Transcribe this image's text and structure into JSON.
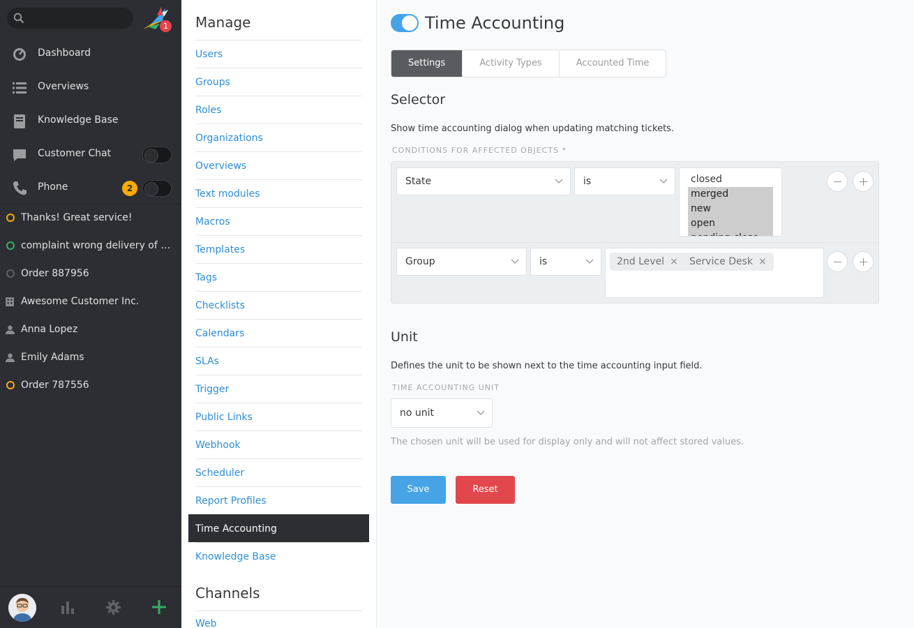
{
  "sidebar": {
    "search_placeholder": "",
    "logo_badge": "1",
    "nav": [
      {
        "label": "Dashboard",
        "icon": "dashboard-icon"
      },
      {
        "label": "Overviews",
        "icon": "overviews-icon"
      },
      {
        "label": "Knowledge Base",
        "icon": "knowledge-base-icon"
      },
      {
        "label": "Customer Chat",
        "icon": "chat-icon"
      },
      {
        "label": "Phone",
        "icon": "phone-icon",
        "badge": "2"
      }
    ],
    "tasks": [
      {
        "label": "Thanks! Great service!",
        "icon": "ticket-open-icon",
        "color": "#faab00"
      },
      {
        "label": "complaint wrong delivery of ord...",
        "icon": "ticket-new-icon",
        "color": "#38ad69"
      },
      {
        "label": "Order 887956",
        "icon": "ticket-closed-icon",
        "color": "#5e6166"
      },
      {
        "label": "Awesome Customer Inc.",
        "icon": "organization-icon",
        "color": "#8a8c90"
      },
      {
        "label": "Anna Lopez",
        "icon": "user-icon",
        "color": "#8a8c90"
      },
      {
        "label": "Emily Adams",
        "icon": "user-icon",
        "color": "#8a8c90"
      },
      {
        "label": "Order 787556",
        "icon": "ticket-pending-icon",
        "color": "#faab00"
      }
    ]
  },
  "manage": {
    "title": "Manage",
    "items": [
      "Users",
      "Groups",
      "Roles",
      "Organizations",
      "Overviews",
      "Text modules",
      "Macros",
      "Templates",
      "Tags",
      "Checklists",
      "Calendars",
      "SLAs",
      "Trigger",
      "Public Links",
      "Webhook",
      "Scheduler",
      "Report Profiles",
      "Time Accounting",
      "Knowledge Base"
    ],
    "active_item": "Time Accounting",
    "channels_title": "Channels",
    "channels_first": "Web"
  },
  "main": {
    "title": "Time Accounting",
    "enabled": true,
    "tabs": [
      {
        "label": "Settings",
        "active": true
      },
      {
        "label": "Activity Types",
        "active": false
      },
      {
        "label": "Accounted Time",
        "active": false
      }
    ],
    "selector": {
      "title": "Selector",
      "description": "Show time accounting dialog when updating matching tickets.",
      "conditions_label": "Conditions for affected objects *",
      "row1": {
        "attribute": "State",
        "operator": "is",
        "options": [
          {
            "label": "closed",
            "selected": false
          },
          {
            "label": "merged",
            "selected": true
          },
          {
            "label": "new",
            "selected": true
          },
          {
            "label": "open",
            "selected": true
          },
          {
            "label": "pending close",
            "selected": true
          }
        ]
      },
      "row2": {
        "attribute": "Group",
        "operator": "is",
        "tags": [
          "2nd Level",
          "Service Desk"
        ]
      }
    },
    "unit": {
      "title": "Unit",
      "description": "Defines the unit to be shown next to the time accounting input field.",
      "field_label": "Time Accounting Unit",
      "value": "no unit",
      "hint": "The chosen unit will be used for display only and will not affect stored values."
    },
    "buttons": {
      "save": "Save",
      "reset": "Reset"
    }
  },
  "colors": {
    "accent": "#45a3e6",
    "danger": "#e2474d",
    "sidebar_bg": "#2c2e33",
    "link": "#2f8ed6"
  }
}
